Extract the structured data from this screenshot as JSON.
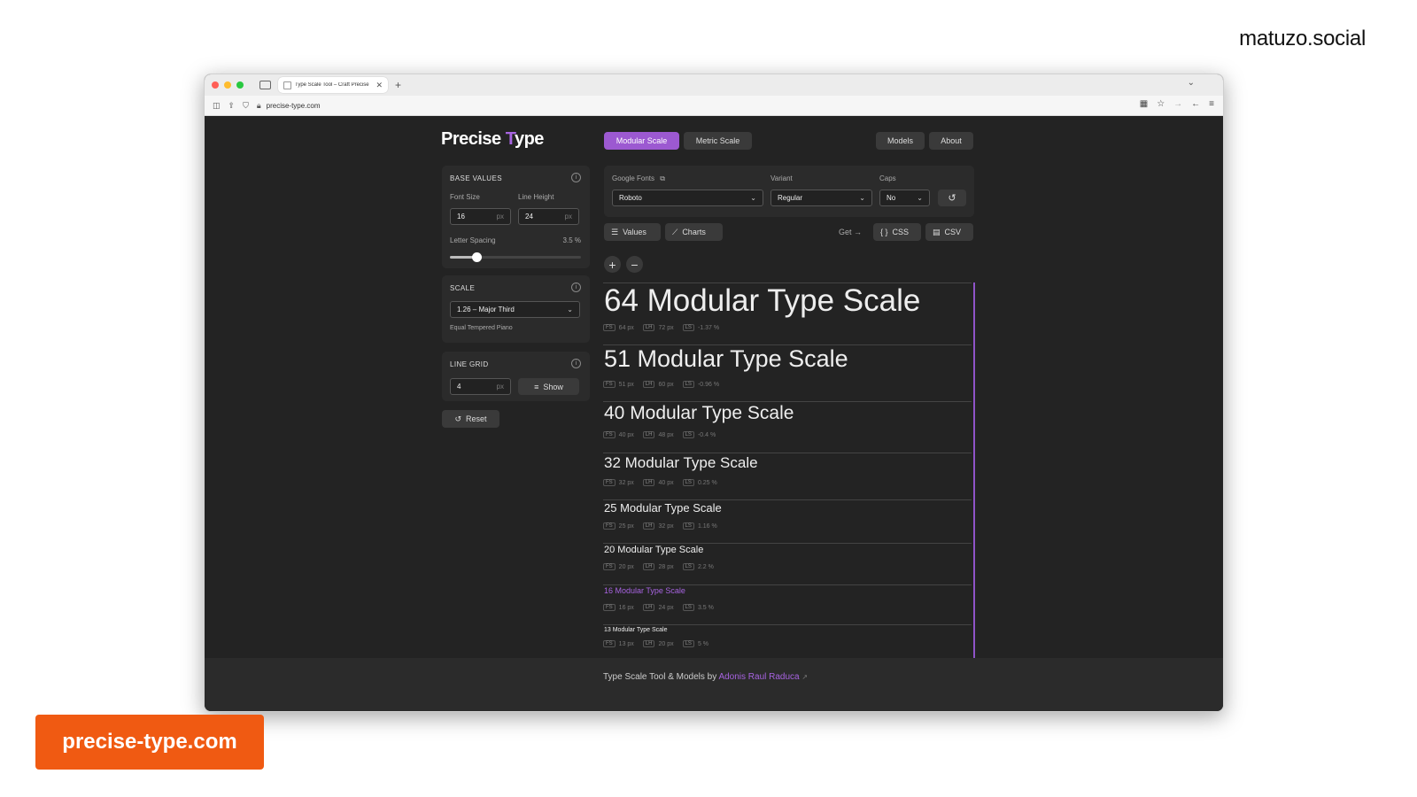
{
  "watermark": "matuzo.social",
  "badge": "precise-type.com",
  "browser": {
    "tab_title": "Type Scale Tool – Craft Precise",
    "tab_close": "✕",
    "new_tab": "+",
    "url": "precise-type.com"
  },
  "app": {
    "logo_text_a": "Precise ",
    "logo_mark": "T",
    "logo_text_b": "ype",
    "modes": [
      "Modular Scale",
      "Metric Scale"
    ],
    "active_mode": "Modular Scale",
    "nav": [
      "Models",
      "About"
    ]
  },
  "base_values": {
    "title": "BASE VALUES",
    "font_size_label": "Font Size",
    "font_size": "16",
    "line_height_label": "Line Height",
    "line_height": "24",
    "unit": "px",
    "letter_spacing_label": "Letter Spacing",
    "letter_spacing_value": "3.5 %",
    "letter_spacing_slider": 0.2
  },
  "scale": {
    "title": "SCALE",
    "selected": "1.26 – Major Third",
    "note": "Equal Tempered Piano"
  },
  "line_grid": {
    "title": "LINE GRID",
    "value": "4",
    "unit": "px",
    "show_label": "Show"
  },
  "reset_label": "Reset",
  "fonts": {
    "google_fonts_label": "Google Fonts",
    "font": "Roboto",
    "variant_label": "Variant",
    "variant": "Regular",
    "caps_label": "Caps",
    "caps": "No"
  },
  "toolbar": {
    "values_label": "Values",
    "charts_label": "Charts",
    "get_label": "Get →",
    "css_label": "CSS",
    "csv_label": "CSV"
  },
  "scale_rows": [
    {
      "text": "64 Modular Type Scale",
      "fs": "64 px",
      "lh": "72 px",
      "ls": "-1.37 %",
      "highlight": false
    },
    {
      "text": "51 Modular Type Scale",
      "fs": "51 px",
      "lh": "60 px",
      "ls": "-0.96 %",
      "highlight": false
    },
    {
      "text": "40 Modular Type Scale",
      "fs": "40 px",
      "lh": "48 px",
      "ls": "-0.4 %",
      "highlight": false
    },
    {
      "text": "32 Modular Type Scale",
      "fs": "32 px",
      "lh": "40 px",
      "ls": "0.25 %",
      "highlight": false
    },
    {
      "text": "25 Modular Type Scale",
      "fs": "25 px",
      "lh": "32 px",
      "ls": "1.16 %",
      "highlight": false
    },
    {
      "text": "20 Modular Type Scale",
      "fs": "20 px",
      "lh": "28 px",
      "ls": "2.2 %",
      "highlight": false
    },
    {
      "text": "16 Modular Type Scale",
      "fs": "16 px",
      "lh": "24 px",
      "ls": "3.5 %",
      "highlight": true
    },
    {
      "text": "13 Modular Type Scale",
      "fs": "13 px",
      "lh": "20 px",
      "ls": "5 %",
      "highlight": false
    }
  ],
  "meta_tags": {
    "fs": "FS",
    "lh": "LH",
    "ls": "LS"
  },
  "footer": {
    "text": "Type Scale Tool & Models by ",
    "link": "Adonis Raul Raduca",
    "link_icon": "↗"
  },
  "colors": {
    "accent": "#9c59d1",
    "badge": "#f05a12",
    "background": "#232323"
  }
}
